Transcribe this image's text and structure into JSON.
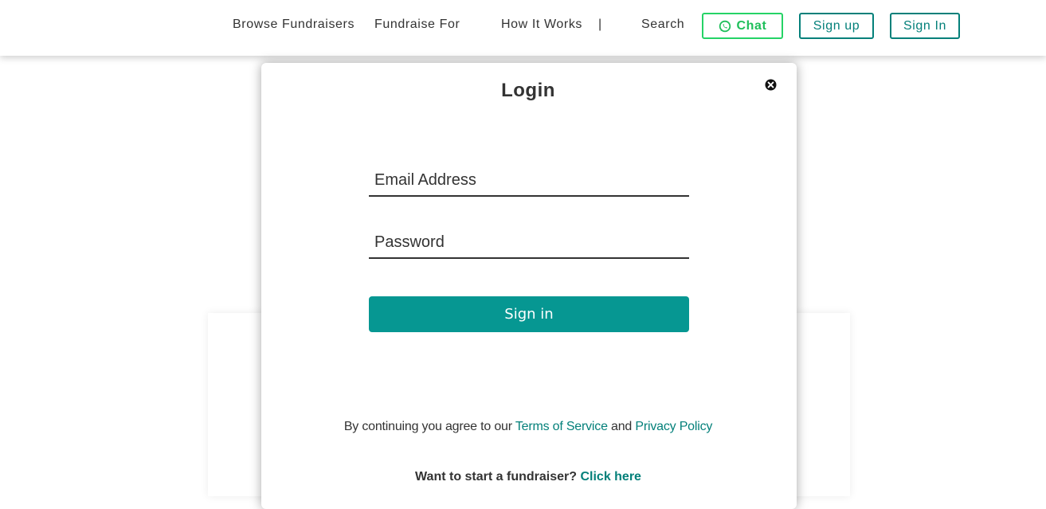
{
  "header": {
    "nav": {
      "browse": "Browse Fundraisers",
      "fundraise_for": "Fundraise For",
      "how_it_works": "How It Works",
      "separator": "|",
      "search": "Search"
    },
    "chat_label": "Chat",
    "chat_icon": "whatsapp-icon",
    "signup_label": "Sign up",
    "signin_label": "Sign In"
  },
  "modal": {
    "title": "Login",
    "close_icon": "close-icon",
    "email_placeholder": "Email Address",
    "password_placeholder": "Password",
    "submit_label": "Sign in",
    "terms": {
      "prefix": "By continuing you agree to our",
      "tos": "Terms of Service",
      "and": "and",
      "privacy": "Privacy Policy"
    },
    "start": {
      "question": "Want to start a fundraiser?",
      "link": "Click here"
    }
  },
  "colors": {
    "accent": "#069792",
    "link": "#04807a",
    "chat": "#25d366",
    "text": "#333333"
  }
}
